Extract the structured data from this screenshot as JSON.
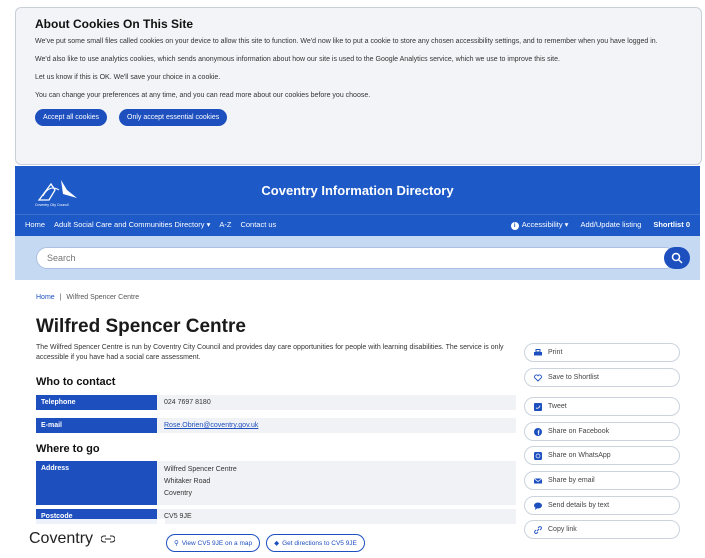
{
  "cookie": {
    "title": "About Cookies On This Site",
    "p1": "We've put some small files called cookies on your device to allow this site to function. We'd now like to put a cookie to store any chosen accessibility settings, and to remember when you have logged in.",
    "p2": "We'd also like to use analytics cookies, which sends anonymous information about how our site is used to the Google Analytics service, which we use to improve this site.",
    "p3": "Let us know if this is OK. We'll save your choice in a cookie.",
    "p4": "You can change your preferences at any time, and you can read more about our cookies before you choose.",
    "accept_all": "Accept all cookies",
    "accept_essential": "Only accept essential cookies"
  },
  "header": {
    "brand_text": "Coventry City Council",
    "site_title": "Coventry Information Directory",
    "nav_left": [
      "Home",
      "Adult Social Care and Communities Directory ▾",
      "A-Z",
      "Contact us"
    ],
    "accessibility": "Accessibility ▾",
    "add_update": "Add/Update listing",
    "shortlist": "Shortlist 0"
  },
  "search": {
    "placeholder": "Search"
  },
  "breadcrumb": {
    "home": "Home",
    "sep": "|",
    "current": "Wilfred Spencer Centre"
  },
  "page": {
    "title": "Wilfred Spencer Centre",
    "description": "The Wilfred Spencer Centre is run by Coventry City Council and provides day care opportunities for people with learning disabilities. The service is only accessible if you have had a social care assessment.",
    "who_heading": "Who to contact",
    "where_heading": "Where to go",
    "telephone_label": "Telephone",
    "telephone_value": "024 7697 8180",
    "email_label": "E-mail",
    "email_value": "Rose.Obrien@coventry.gov.uk",
    "address_label": "Address",
    "address_lines": [
      "Wilfred Spencer Centre",
      "Whitaker Road",
      "Coventry"
    ],
    "postcode_label": "Postcode",
    "postcode_value": "CV5 9JE",
    "map_button": "View CV5 9JE on a map",
    "directions_button": "Get directions to CV5 9JE"
  },
  "share": {
    "print": "Print",
    "save": "Save to Shortlist",
    "tweet": "Tweet",
    "facebook": "Share on Facebook",
    "whatsapp": "Share on WhatsApp",
    "email": "Share by email",
    "text": "Send details by text",
    "copy": "Copy link"
  },
  "overlay": {
    "label": "Coventry"
  },
  "colors": {
    "primary": "#1d59c7",
    "dark": "#1d4fbf",
    "searchbar": "#c6d9f2"
  }
}
